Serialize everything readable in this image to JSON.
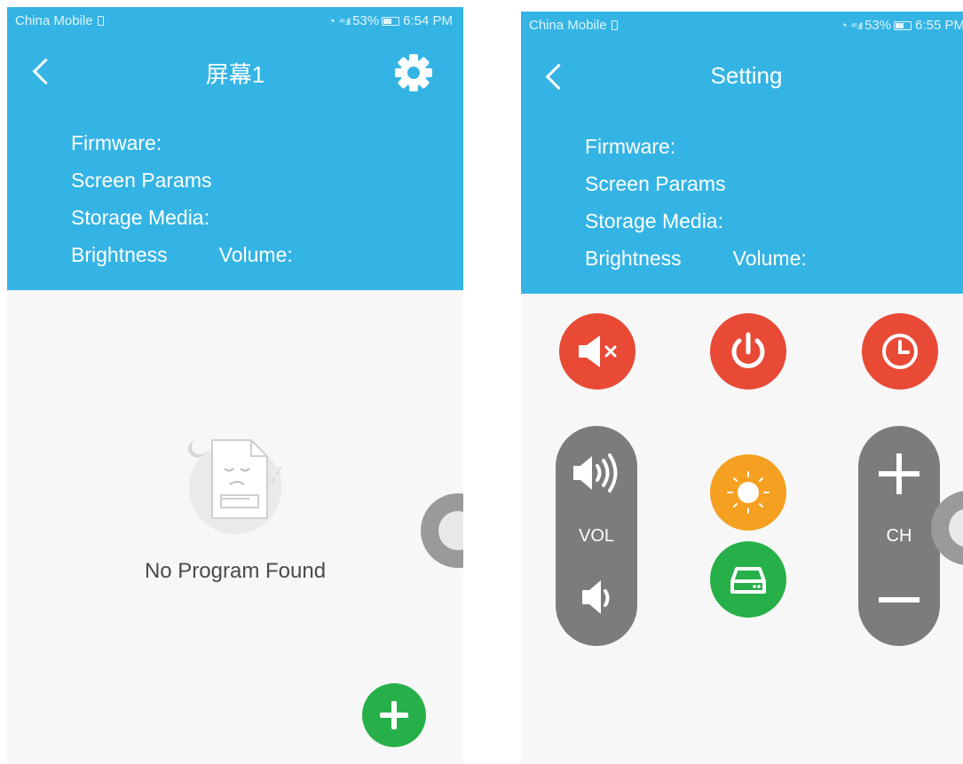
{
  "left_screen": {
    "status_bar": {
      "carrier": "China Mobile",
      "signal": "⁴⁶.ıll",
      "battery_percent": "53%",
      "time": "6:54 PM"
    },
    "title": "屏幕1",
    "info": {
      "firmware": "Firmware:",
      "screen_params": "Screen Params",
      "storage_media": "Storage Media:",
      "brightness": "Brightness",
      "volume": "Volume:"
    },
    "empty_state": {
      "message": "No Program Found"
    },
    "icons": {
      "back": "chevron-left-icon",
      "settings": "gear-icon",
      "add": "plus-icon"
    }
  },
  "right_screen": {
    "status_bar": {
      "carrier": "China Mobile",
      "signal": "⁴⁶.ıll",
      "battery_percent": "53%",
      "time": "6:55 PM"
    },
    "title": "Setting",
    "info": {
      "firmware": "Firmware:",
      "screen_params": "Screen Params",
      "storage_media": "Storage Media:",
      "brightness": "Brightness",
      "volume": "Volume:"
    },
    "remote": {
      "volume_label": "VOL",
      "channel_label": "CH",
      "buttons": [
        "mute-icon",
        "power-icon",
        "clock-icon",
        "volume-up-icon",
        "volume-down-icon",
        "sun-icon",
        "storage-drive-icon",
        "plus-icon",
        "minus-icon"
      ]
    }
  },
  "colors": {
    "header_blue": "#34b4e4",
    "red": "#e84a36",
    "orange": "#f5a020",
    "green": "#27b049",
    "pill_gray": "#7c7c7c",
    "background": "#f7f7f7"
  }
}
